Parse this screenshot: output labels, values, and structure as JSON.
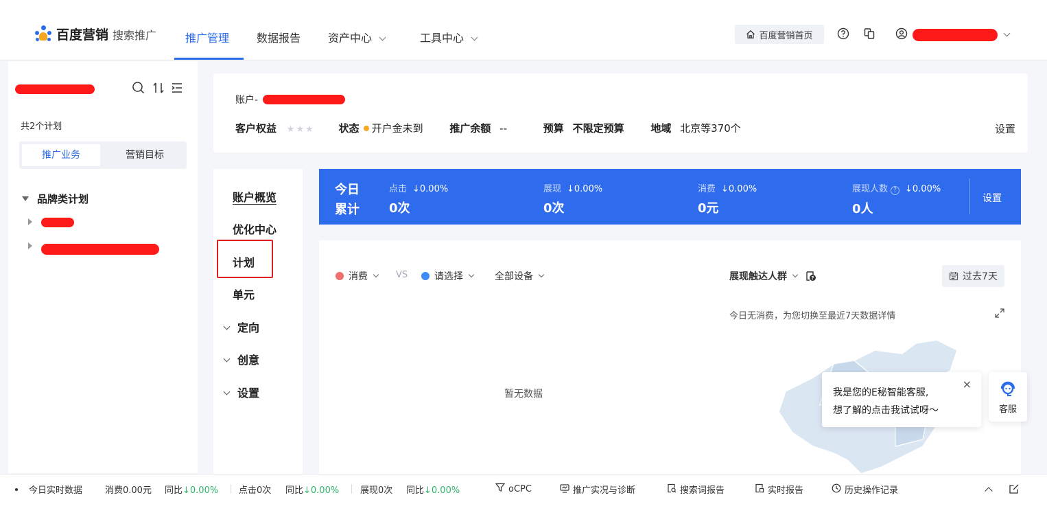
{
  "nav": {
    "brand": "百度营销",
    "product": "搜索推广",
    "items": [
      {
        "label": "推广管理",
        "active": true
      },
      {
        "label": "数据报告"
      },
      {
        "label": "资产中心"
      },
      {
        "label": "工具中心"
      }
    ],
    "home_label": "百度营销首页"
  },
  "left_panel": {
    "plan_count": "共2个计划",
    "tabs": [
      "推广业务",
      "营销目标"
    ],
    "tree_root": "品牌类计划"
  },
  "account": {
    "label": "账户-",
    "rights_label": "客户权益",
    "stars": "★★★",
    "status_label": "状态",
    "status_value": "开户金未到",
    "balance_label": "推广余额",
    "balance_value": "--",
    "budget_label": "预算",
    "budget_value": "不限定预算",
    "region_label": "地域",
    "region_value": "北京等370个",
    "settings": "设置"
  },
  "side_menu": {
    "items": [
      "账户概览",
      "优化中心",
      "计划",
      "单元",
      "定向",
      "创意",
      "设置"
    ]
  },
  "stats": {
    "today_line1": "今日",
    "today_line2": "累计",
    "items": [
      {
        "label": "点击",
        "change": "↓0.00%",
        "value": "0次"
      },
      {
        "label": "展现",
        "change": "↓0.00%",
        "value": "0次"
      },
      {
        "label": "消费",
        "change": "↓0.00%",
        "value": "0元"
      },
      {
        "label": "展现人数",
        "change": "↓0.00%",
        "value": "0人"
      }
    ],
    "settings": "设置"
  },
  "chart": {
    "metric1": "消费",
    "vs": "VS",
    "metric2": "请选择",
    "device": "全部设备",
    "audience": "展现触达人群",
    "period": "过去7天",
    "note": "今日无消费，为您切换至最近7天数据详情",
    "no_data": "暂无数据",
    "colors": {
      "metric1": "#f07070",
      "metric2": "#3d8bf5"
    }
  },
  "cs": {
    "line1": "我是您的E秘智能客服,",
    "line2": "想了解的点击我试试呀～",
    "close": "×",
    "label": "客服"
  },
  "bottom": {
    "realtime": "今日实时数据",
    "cost": "消费0.00元",
    "yoy1": "同比",
    "chg1": "↓0.00%",
    "clicks": "点击0次",
    "yoy2": "同比",
    "chg2": "↓0.00%",
    "impr": "展现0次",
    "yoy3": "同比",
    "chg3": "↓0.00%",
    "ocpc": "oCPC",
    "diagnose": "推广实况与诊断",
    "search_report": "搜索词报告",
    "realtime_report": "实时报告",
    "history": "历史操作记录"
  }
}
